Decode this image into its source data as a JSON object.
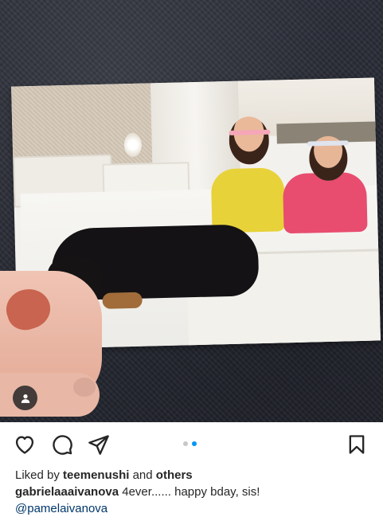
{
  "post": {
    "carousel": {
      "total": 2,
      "current": 2
    },
    "colors": {
      "accent": "#0095f6",
      "inactive_dot": "#c7c7c7",
      "link": "#00376b"
    }
  },
  "icons": {
    "like": "heart-icon",
    "comment": "comment-icon",
    "share": "paper-plane-icon",
    "save": "bookmark-icon",
    "tag": "user-tag-icon"
  },
  "likes": {
    "prefix": "Liked by",
    "user": "teemenushi",
    "joiner": "and",
    "others": "others"
  },
  "caption": {
    "username": "gabrielaaaivanova",
    "text": "4ever...... happy bday, sis!",
    "mention": "@pamelaivanova"
  }
}
